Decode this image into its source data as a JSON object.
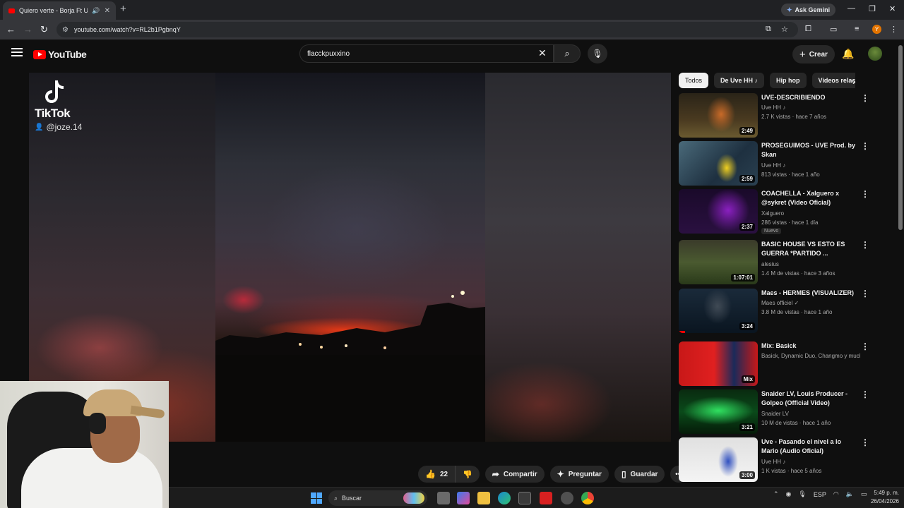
{
  "browser": {
    "tab_title": "Quiero verte - Borja Ft Uvé",
    "new_tab_symbol": "+",
    "gemini_label": "Ask Gemini",
    "url": "youtube.com/watch?v=RL2b1PgbnqY",
    "profile_initial": "Y"
  },
  "youtube": {
    "logo_text": "YouTube",
    "search_value": "flacckpuxxino",
    "create_label": "Crear"
  },
  "video": {
    "watermark_brand": "TikTok",
    "watermark_user": "@joze.14"
  },
  "actions": {
    "like_count": "22",
    "share_label": "Compartir",
    "ask_label": "Preguntar",
    "save_label": "Guardar"
  },
  "chips": [
    "Todos",
    "De Uve HH ♪",
    "Hip hop",
    "Videos relac"
  ],
  "recommendations": [
    {
      "title": "UVE-DESCRIBIENDO",
      "channel": "Uve HH ♪",
      "meta": "2.7 K vistas · hace 7 años",
      "duration": "2:49",
      "badge": ""
    },
    {
      "title": "PROSEGUIMOS - UVE      Prod. by Skan",
      "channel": "Uve HH ♪",
      "meta": "813 vistas · hace 1 año",
      "duration": "2:59",
      "badge": ""
    },
    {
      "title": "COACHELLA - Xalguero x @sykret (Video Oficial)",
      "channel": "Xalguero",
      "meta": "286 vistas · hace 1 día",
      "duration": "2:37",
      "badge": "Nuevo"
    },
    {
      "title": "BASIC HOUSE VS ESTO ES GUERRA *PARTIDO ...",
      "channel": "alesius",
      "meta": "1.4 M de vistas · hace 3 años",
      "duration": "1:07:01",
      "badge": ""
    },
    {
      "title": "Maes - HERMES (VISUALIZER)",
      "channel": "Maes officiel ✓",
      "meta": "3.8 M de vistas · hace 1 año",
      "duration": "3:24",
      "badge": ""
    },
    {
      "title": "Mix: Basick",
      "channel": "Basick, Dynamic Duo, Changmo y mucho...",
      "meta": "",
      "duration": "Mix",
      "badge": ""
    },
    {
      "title": "Snaider LV, Louis Producer - Golpeo (Official Video)",
      "channel": "Snaider LV",
      "meta": "10 M de vistas · hace 1 año",
      "duration": "3:21",
      "badge": ""
    },
    {
      "title": "Uve - Pasando el nivel a lo Mario (Audio Oficial)",
      "channel": "Uve HH ♪",
      "meta": "1 K vistas · hace 5 años",
      "duration": "3:00",
      "badge": ""
    }
  ],
  "taskbar": {
    "search_label": "Buscar",
    "lang": "ESP",
    "time": "5:49 p. m.",
    "date": "26/04/2026"
  }
}
